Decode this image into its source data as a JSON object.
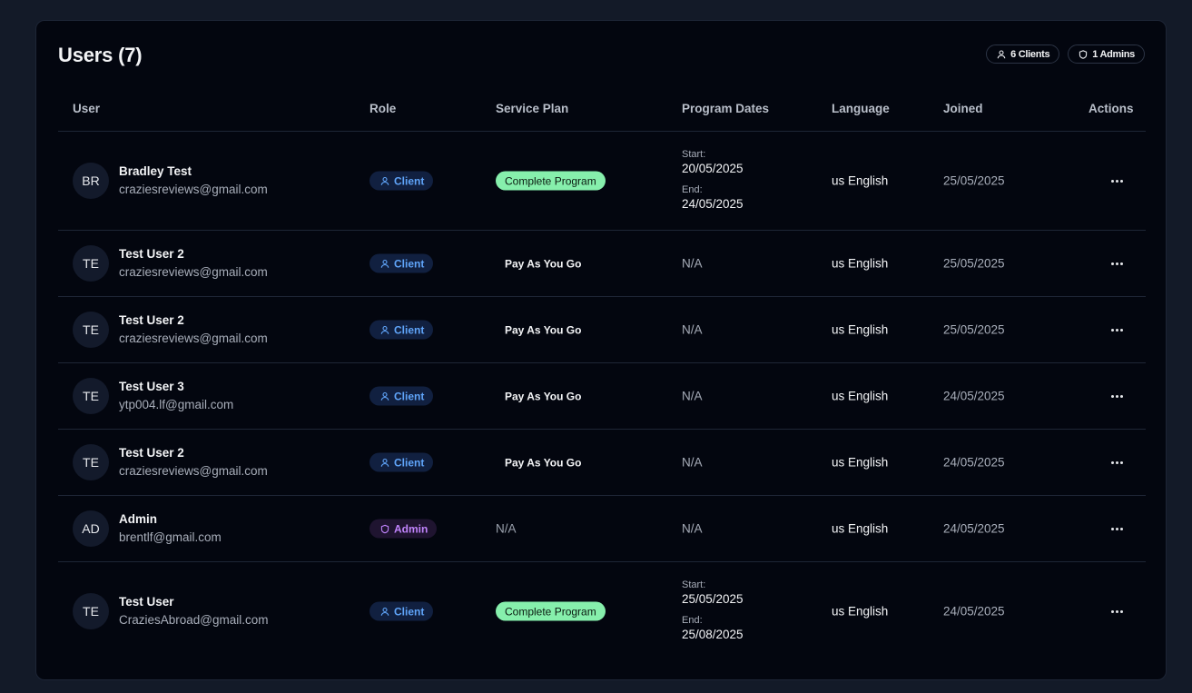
{
  "title": "Users (7)",
  "pills": {
    "clients": "6 Clients",
    "admins": "1 Admins"
  },
  "columns": [
    "User",
    "Role",
    "Service Plan",
    "Program Dates",
    "Language",
    "Joined",
    "Actions"
  ],
  "rows": [
    {
      "initials": "BR",
      "name": "Bradley Test",
      "email": "craziesreviews@gmail.com",
      "role": "Client",
      "plan": "Complete Program",
      "start_label": "Start:",
      "start": "20/05/2025",
      "end_label": "End:",
      "end": "24/05/2025",
      "language": "us English",
      "joined": "25/05/2025"
    },
    {
      "initials": "TE",
      "name": "Test User 2",
      "email": "craziesreviews@gmail.com",
      "role": "Client",
      "plan": "Pay As You Go",
      "dates": "N/A",
      "language": "us English",
      "joined": "25/05/2025"
    },
    {
      "initials": "TE",
      "name": "Test User 2",
      "email": "craziesreviews@gmail.com",
      "role": "Client",
      "plan": "Pay As You Go",
      "dates": "N/A",
      "language": "us English",
      "joined": "25/05/2025"
    },
    {
      "initials": "TE",
      "name": "Test User 3",
      "email": "ytp004.lf@gmail.com",
      "role": "Client",
      "plan": "Pay As You Go",
      "dates": "N/A",
      "language": "us English",
      "joined": "24/05/2025"
    },
    {
      "initials": "TE",
      "name": "Test User 2",
      "email": "craziesreviews@gmail.com",
      "role": "Client",
      "plan": "Pay As You Go",
      "dates": "N/A",
      "language": "us English",
      "joined": "24/05/2025"
    },
    {
      "initials": "AD",
      "name": "Admin",
      "email": "brentlf@gmail.com",
      "role": "Admin",
      "plan": "N/A",
      "dates": "N/A",
      "language": "us English",
      "joined": "24/05/2025"
    },
    {
      "initials": "TE",
      "name": "Test User",
      "email": "CraziesAbroad@gmail.com",
      "role": "Client",
      "plan": "Complete Program",
      "start_label": "Start:",
      "start": "25/05/2025",
      "end_label": "End:",
      "end": "25/08/2025",
      "language": "us English",
      "joined": "24/05/2025"
    }
  ],
  "icons": {
    "client": "user-icon",
    "admin": "shield-icon",
    "actions": "more-horizontal-icon"
  },
  "colors": {
    "background": "#131a28",
    "card": "#03060f",
    "client_badge": "#60a5fa",
    "admin_badge": "#c084fc",
    "complete_program": "#86efac"
  }
}
